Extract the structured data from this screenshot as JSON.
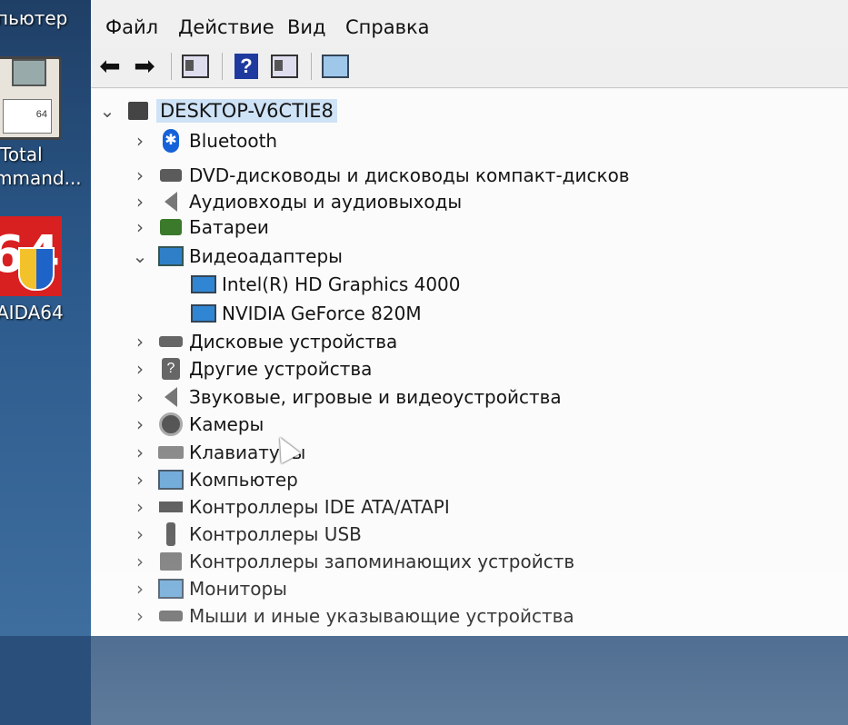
{
  "desktop": {
    "top_label": "пьютер",
    "floppy_label": "64",
    "total_label_1": "Total",
    "total_label_2": "mmand...",
    "aida_tile_text": "64",
    "aida_label": "AIDA64"
  },
  "menu": [
    "Файл",
    "Действие",
    "Вид",
    "Справка"
  ],
  "toolbar": {
    "back": "back-icon",
    "forward": "forward-icon",
    "properties": "properties-icon",
    "help": "help-icon",
    "help_glyph": "?",
    "action": "action-pane-icon",
    "scan": "scan-hardware-icon"
  },
  "tree": {
    "root": "DESKTOP-V6CTIE8",
    "categories": [
      {
        "label": "Bluetooth",
        "icon": "bluetooth-icon",
        "expanded": false
      },
      {
        "label": "DVD-дисководы и дисководы компакт-дисков",
        "icon": "dvd-drive-icon",
        "expanded": false
      },
      {
        "label": "Аудиовходы и аудиовыходы",
        "icon": "speaker-icon",
        "expanded": false
      },
      {
        "label": "Батареи",
        "icon": "battery-icon",
        "expanded": false
      },
      {
        "label": "Видеоадаптеры",
        "icon": "display-adapter-icon",
        "expanded": true
      },
      {
        "label": "Intel(R) HD Graphics 4000",
        "icon": "display-adapter-icon",
        "child": true
      },
      {
        "label": "NVIDIA GeForce 820M",
        "icon": "display-adapter-icon",
        "child": true
      },
      {
        "label": "Дисковые устройства",
        "icon": "disk-drive-icon",
        "expanded": false
      },
      {
        "label": "Другие устройства",
        "icon": "unknown-device-icon",
        "expanded": false
      },
      {
        "label": "Звуковые, игровые и видеоустройства",
        "icon": "speaker-icon",
        "expanded": false
      },
      {
        "label": "Камеры",
        "icon": "camera-icon",
        "expanded": false
      },
      {
        "label": "Клавиатуры",
        "icon": "keyboard-icon",
        "expanded": false
      },
      {
        "label": "Компьютер",
        "icon": "computer-icon",
        "expanded": false
      },
      {
        "label": "Контроллеры IDE ATA/ATAPI",
        "icon": "ide-controller-icon",
        "expanded": false
      },
      {
        "label": "Контроллеры USB",
        "icon": "usb-icon",
        "expanded": false
      },
      {
        "label": "Контроллеры запоминающих устройств",
        "icon": "storage-controller-icon",
        "expanded": false
      },
      {
        "label": "Мониторы",
        "icon": "monitor-icon",
        "expanded": false
      },
      {
        "label": "Мыши и иные указывающие устройства",
        "icon": "mouse-icon",
        "expanded": false
      }
    ]
  },
  "colors": {
    "selection": "#cfe3f7",
    "accent_blue": "#1662d8"
  }
}
